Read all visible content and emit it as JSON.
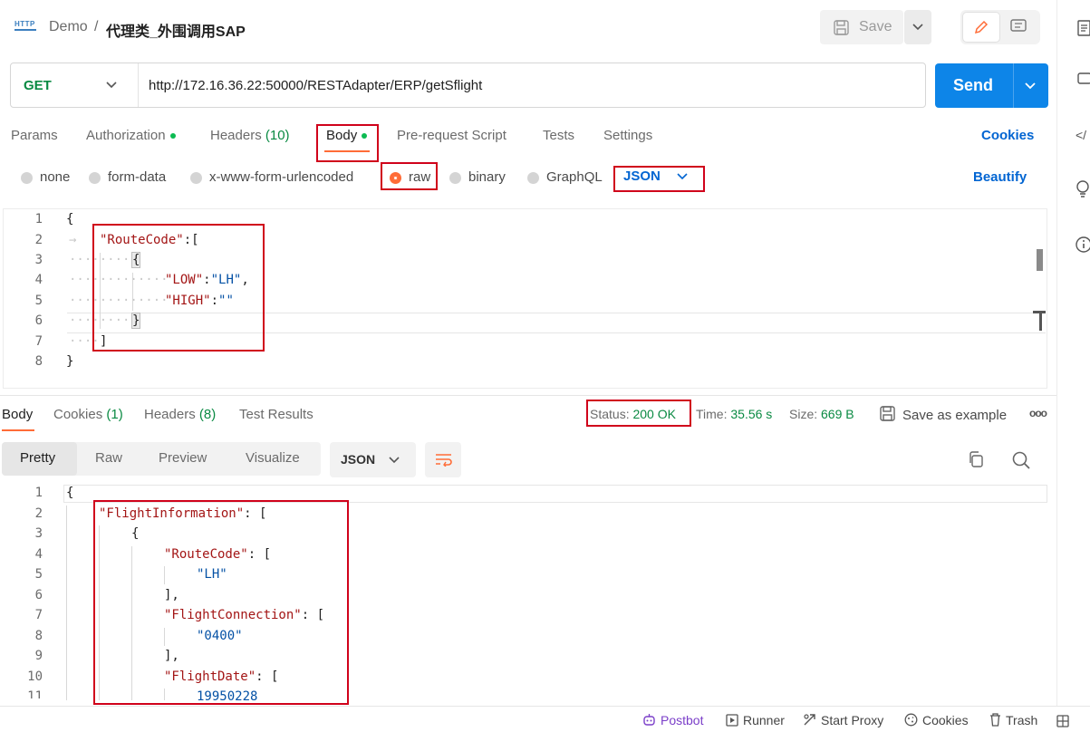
{
  "header": {
    "http_icon_label": "HTTP",
    "breadcrumb_parent": "Demo",
    "breadcrumb_sep": "/",
    "request_name": "代理类_外围调用SAP",
    "save_label": "Save"
  },
  "request": {
    "method": "GET",
    "url": "http://172.16.36.22:50000/RESTAdapter/ERP/getSflight",
    "send_label": "Send"
  },
  "request_tabs": {
    "params": "Params",
    "authorization": "Authorization",
    "headers": "Headers",
    "headers_count": "(10)",
    "body": "Body",
    "pre_request": "Pre-request Script",
    "tests": "Tests",
    "settings": "Settings",
    "cookies": "Cookies"
  },
  "body_options": {
    "none": "none",
    "form_data": "form-data",
    "urlencoded": "x-www-form-urlencoded",
    "raw": "raw",
    "binary": "binary",
    "graphql": "GraphQL",
    "format": "JSON",
    "beautify": "Beautify"
  },
  "request_body_lines": [
    "1",
    "2",
    "3",
    "4",
    "5",
    "6",
    "7",
    "8"
  ],
  "request_body": {
    "l1": "{",
    "l2_key": "\"RouteCode\"",
    "l2_rest": ":[",
    "l3": "{",
    "l4_key": "\"LOW\"",
    "l4_colon": ":",
    "l4_val": "\"LH\"",
    "l4_comma": ",",
    "l5_key": "\"HIGH\"",
    "l5_colon": ":",
    "l5_val": "\"\"",
    "l6": "}",
    "l7": "]",
    "l8": "}"
  },
  "response_tabs": {
    "body": "Body",
    "cookies": "Cookies",
    "cookies_count": "(1)",
    "headers": "Headers",
    "headers_count": "(8)",
    "test_results": "Test Results"
  },
  "response_meta": {
    "status_label": "Status:",
    "status_value": "200 OK",
    "time_label": "Time:",
    "time_value": "35.56 s",
    "size_label": "Size:",
    "size_value": "669 B",
    "save_example": "Save as example",
    "more": "ooo"
  },
  "response_view": {
    "pretty": "Pretty",
    "raw": "Raw",
    "preview": "Preview",
    "visualize": "Visualize",
    "format": "JSON"
  },
  "response_body_lines": [
    "1",
    "2",
    "3",
    "4",
    "5",
    "6",
    "7",
    "8",
    "9",
    "10",
    "11"
  ],
  "response_body": {
    "l1": "{",
    "l2_key": "\"FlightInformation\"",
    "l2_rest": ": [",
    "l3": "{",
    "l4_key": "\"RouteCode\"",
    "l4_rest": ": [",
    "l5_val": "\"LH\"",
    "l6": "],",
    "l7_key": "\"FlightConnection\"",
    "l7_rest": ": [",
    "l8_val": "\"0400\"",
    "l9": "],",
    "l10_key": "\"FlightDate\"",
    "l10_rest": ": [",
    "l11_val": "19950228"
  },
  "footer": {
    "postbot": "Postbot",
    "runner": "Runner",
    "start_proxy": "Start Proxy",
    "cookies": "Cookies",
    "trash": "Trash"
  },
  "colors": {
    "accent": "#ff6c37",
    "send": "#0d85e8",
    "link": "#0265d2",
    "status_ok": "#0a8a43",
    "highlight": "#d0021b"
  }
}
